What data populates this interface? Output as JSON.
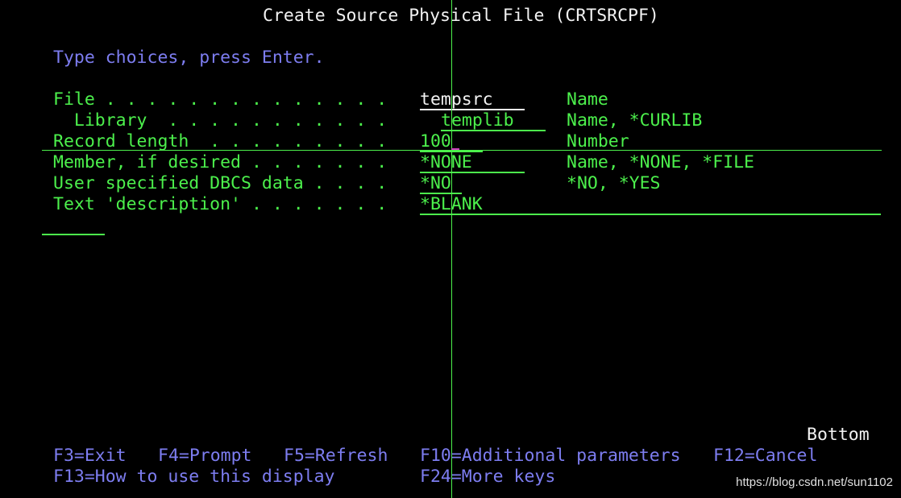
{
  "title": "Create Source Physical File (CRTSRCPF)",
  "instruction": "Type choices, press Enter.",
  "fields": [
    {
      "label": "File . . . . . . . . . . . . . .",
      "value": "tempsrc",
      "hint": "Name"
    },
    {
      "label": "  Library  . . . . . . . . . . .",
      "value": "templib",
      "hint": "Name, *CURLIB"
    },
    {
      "label": "Record length  . . . . . . . . .",
      "value": "100",
      "hint": "Number"
    },
    {
      "label": "Member, if desired . . . . . . .",
      "value": "*NONE",
      "hint": "Name, *NONE, *FILE"
    },
    {
      "label": "User specified DBCS data . . . .",
      "value": "*NO",
      "hint": "*NO, *YES"
    },
    {
      "label": "Text 'description' . . . . . . .",
      "value": "*BLANK",
      "hint": ""
    }
  ],
  "status": "Bottom",
  "function_keys": {
    "row1": [
      {
        "label": "F3=Exit"
      },
      {
        "label": "F4=Prompt"
      },
      {
        "label": "F5=Refresh"
      },
      {
        "label": "F10=Additional parameters"
      },
      {
        "label": "F12=Cancel"
      }
    ],
    "row2": [
      {
        "label": "F13=How to use this display"
      },
      {
        "label": "F24=More keys"
      }
    ]
  },
  "watermark": "https://blog.csdn.net/sun1102",
  "colors": {
    "background": "#000000",
    "green": "#4cf04c",
    "white": "#f2f2f2",
    "blue": "#7d7df0"
  }
}
